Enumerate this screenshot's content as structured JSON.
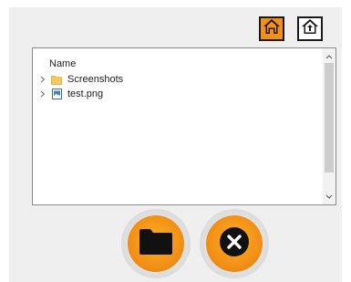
{
  "toolbar": {
    "home_icon": "home-icon",
    "home_up_icon": "home-upload-icon",
    "accent": "#f29017"
  },
  "browser": {
    "column_header": "Name",
    "items": [
      {
        "label": "Screenshots",
        "icon": "folder-icon"
      },
      {
        "label": "test.png",
        "icon": "image-file-icon"
      }
    ]
  },
  "actions": {
    "open_icon": "folder-icon",
    "cancel_icon": "close-icon"
  }
}
